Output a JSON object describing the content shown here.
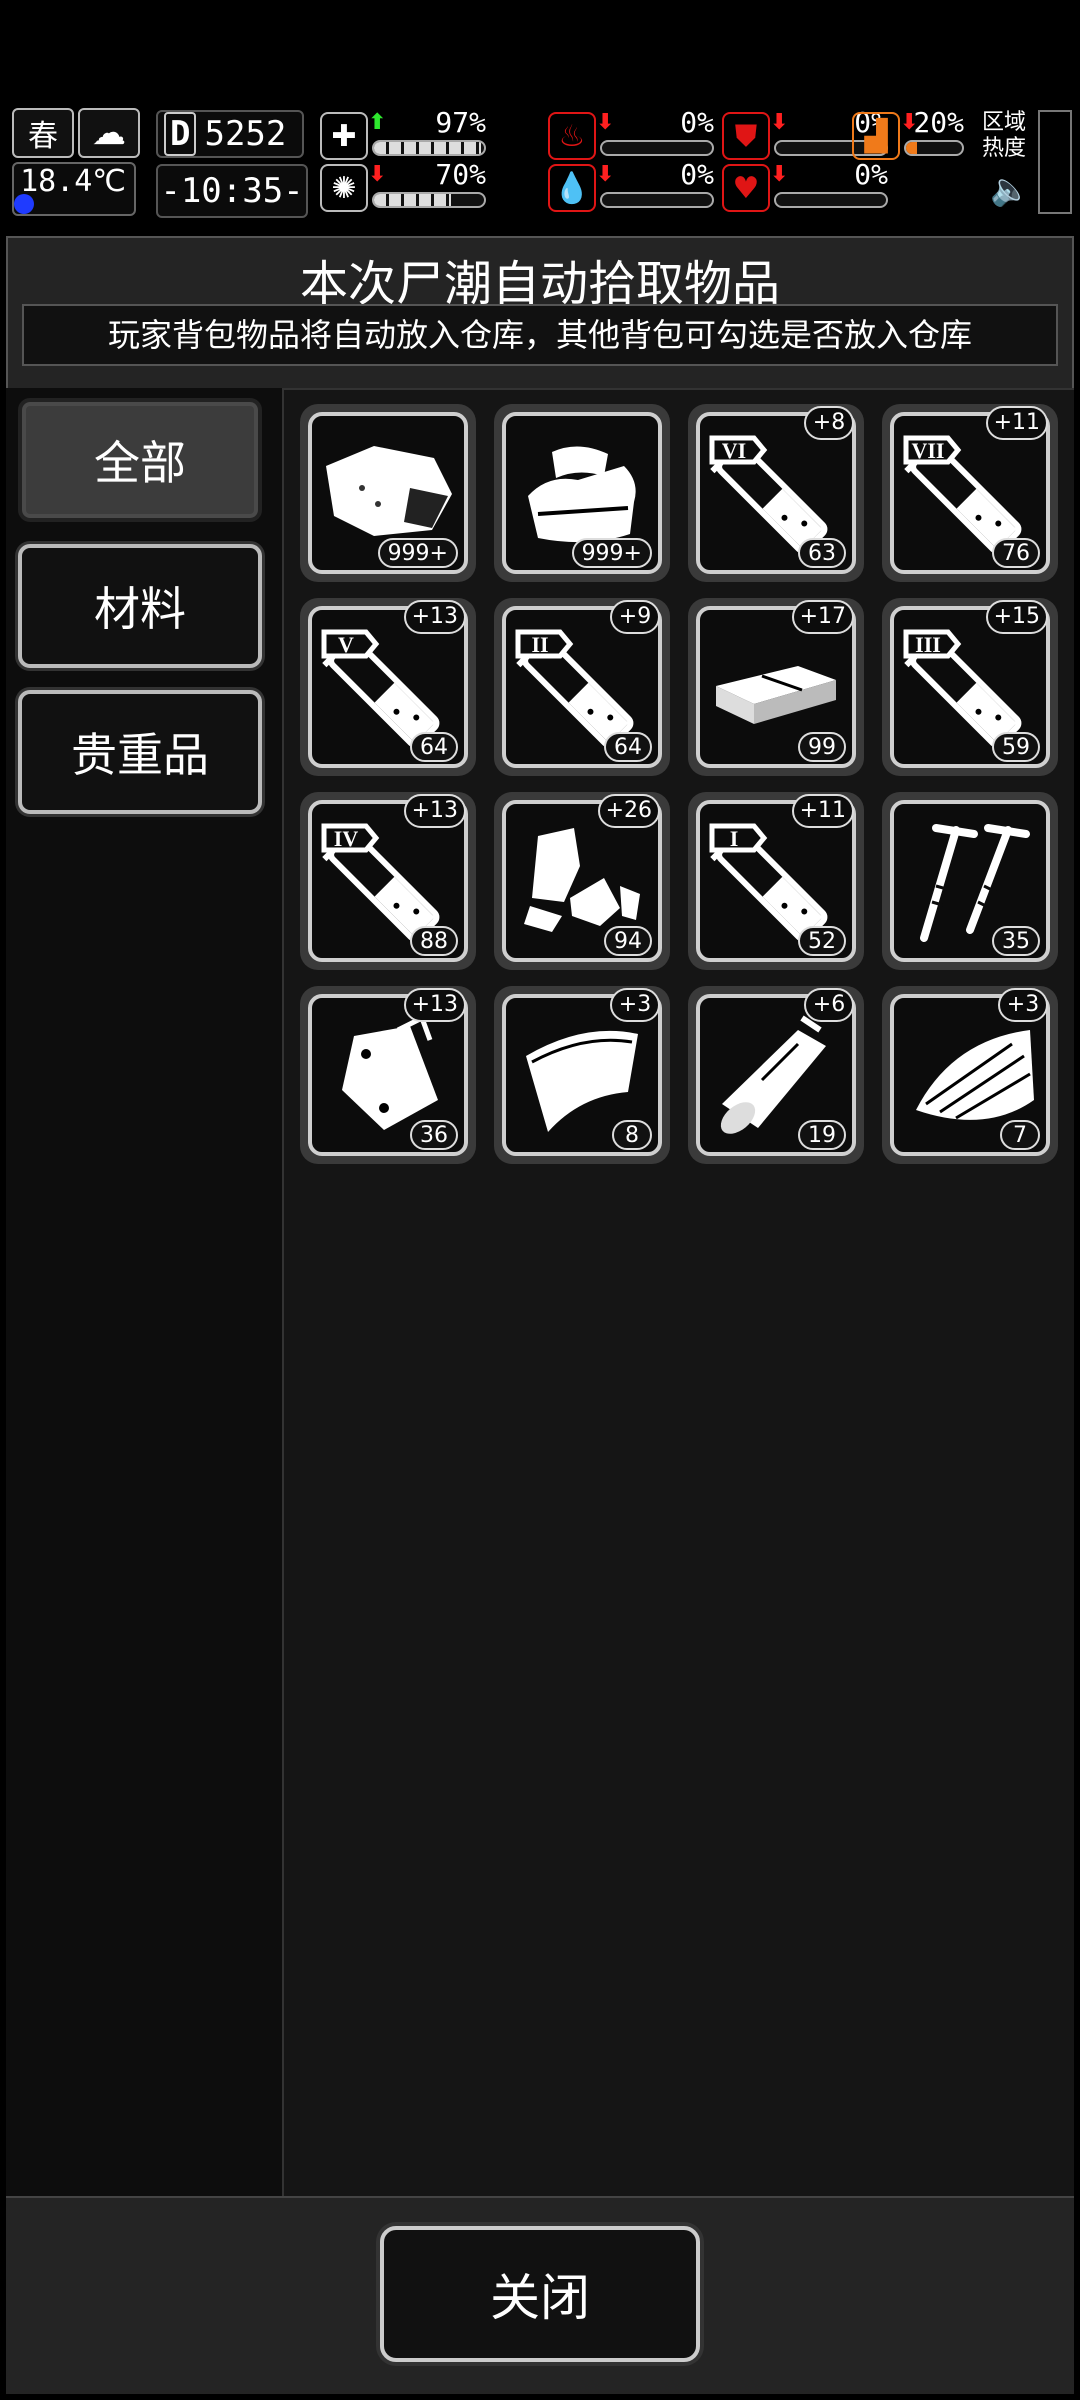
{
  "hud": {
    "season": "春",
    "temperature": "18.4℃",
    "day": "5252",
    "day_prefix": "D",
    "time": "-10:35-",
    "stats": [
      {
        "name": "health",
        "value": "97%",
        "trend": "up",
        "fill": 0.97,
        "color": "#ffffff"
      },
      {
        "name": "stomach",
        "value": "0%",
        "trend": "down",
        "fill": 0,
        "color": "#e01515"
      },
      {
        "name": "thirst",
        "value": "0%",
        "trend": "down",
        "fill": 0,
        "color": "#e01515"
      },
      {
        "name": "brain",
        "value": "70%",
        "trend": "down",
        "fill": 0.7,
        "color": "#ffffff"
      },
      {
        "name": "blood",
        "value": "0%",
        "trend": "down",
        "fill": 0,
        "color": "#e01515"
      },
      {
        "name": "heart",
        "value": "0%",
        "trend": "down",
        "fill": 0,
        "color": "#e01515"
      },
      {
        "name": "stamina",
        "value": "20%",
        "trend": "down",
        "fill": 0.2,
        "color": "#f07a1a"
      }
    ],
    "heat_label": "区域热度"
  },
  "panel": {
    "title": "本次尸潮自动拾取物品",
    "subtitle": "玩家背包物品将自动放入仓库，其他背包可勾选是否放入仓库"
  },
  "categories": [
    {
      "label": "全部",
      "active": true
    },
    {
      "label": "材料",
      "active": false
    },
    {
      "label": "贵重品",
      "active": false
    }
  ],
  "items": [
    {
      "icon": "meat-icon",
      "count": "999+",
      "bonus": ""
    },
    {
      "icon": "cloth-icon",
      "count": "999+",
      "bonus": ""
    },
    {
      "icon": "potion-vi-icon",
      "roman": "VI",
      "count": "63",
      "bonus": "+8"
    },
    {
      "icon": "potion-vii-icon",
      "roman": "VII",
      "count": "76",
      "bonus": "+11"
    },
    {
      "icon": "potion-v-icon",
      "roman": "V",
      "count": "64",
      "bonus": "+13"
    },
    {
      "icon": "potion-ii-icon",
      "roman": "II",
      "count": "64",
      "bonus": "+9"
    },
    {
      "icon": "brick-icon",
      "count": "99",
      "bonus": "+17"
    },
    {
      "icon": "potion-iii-icon",
      "roman": "III",
      "count": "59",
      "bonus": "+15"
    },
    {
      "icon": "potion-iv-icon",
      "roman": "IV",
      "count": "88",
      "bonus": "+13"
    },
    {
      "icon": "scrap-icon",
      "count": "94",
      "bonus": "+26"
    },
    {
      "icon": "potion-i-icon",
      "roman": "I",
      "count": "52",
      "bonus": "+11"
    },
    {
      "icon": "nails-icon",
      "count": "35",
      "bonus": ""
    },
    {
      "icon": "bag-icon",
      "count": "36",
      "bonus": "+13"
    },
    {
      "icon": "sheet-icon",
      "count": "8",
      "bonus": "+3"
    },
    {
      "icon": "wood-icon",
      "count": "19",
      "bonus": "+6"
    },
    {
      "icon": "planks-icon",
      "count": "7",
      "bonus": "+3"
    }
  ],
  "footer": {
    "close_label": "关闭"
  }
}
